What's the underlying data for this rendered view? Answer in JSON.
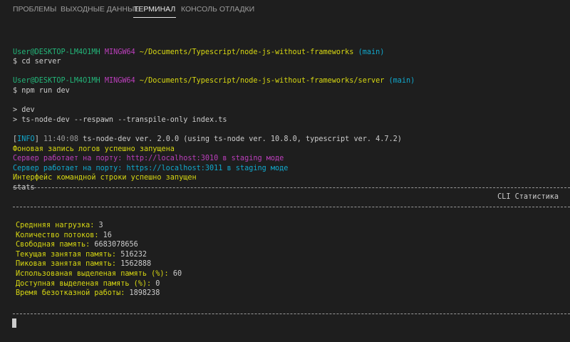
{
  "tabs": [
    {
      "label": "ПРОБЛЕМЫ",
      "active": false
    },
    {
      "label": "ВЫХОДНЫЕ ДАННЫЕ",
      "active": false
    },
    {
      "label": "ТЕРМИНАЛ",
      "active": true
    },
    {
      "label": "КОНСОЛЬ ОТЛАДКИ",
      "active": false
    }
  ],
  "terminal": {
    "lines": [
      [],
      [
        {
          "t": "User@DESKTOP-LM4O1MH ",
          "c": "green"
        },
        {
          "t": "MINGW64 ",
          "c": "magenta"
        },
        {
          "t": "~/Documents/Typescript/node-js-without-frameworks ",
          "c": "yellow"
        },
        {
          "t": "(main)",
          "c": "cyan"
        }
      ],
      [
        {
          "t": "$ cd server",
          "c": "default"
        }
      ],
      [],
      [
        {
          "t": "User@DESKTOP-LM4O1MH ",
          "c": "green"
        },
        {
          "t": "MINGW64 ",
          "c": "magenta"
        },
        {
          "t": "~/Documents/Typescript/node-js-without-frameworks/server ",
          "c": "yellow"
        },
        {
          "t": "(main)",
          "c": "cyan"
        }
      ],
      [
        {
          "t": "$ npm run dev",
          "c": "default"
        }
      ],
      [],
      [
        {
          "t": "> dev",
          "c": "default"
        }
      ],
      [
        {
          "t": "> ts-node-dev --respawn --transpile-only index.ts",
          "c": "default"
        }
      ],
      [],
      [
        {
          "t": "[",
          "c": "default"
        },
        {
          "t": "INFO",
          "c": "cyan"
        },
        {
          "t": "] ",
          "c": "default"
        },
        {
          "t": "11:40:08",
          "c": "gray"
        },
        {
          "t": " ts-node-dev ver. 2.0.0 (using ts-node ver. 10.8.0, typescript ver. 4.7.2)",
          "c": "default"
        }
      ],
      [
        {
          "t": "Фоновая запись логов успешно запущена",
          "c": "yellow"
        }
      ],
      [
        {
          "t": "Сервер работает на порту: http://localhost:3010 в staging моде",
          "c": "magenta"
        }
      ],
      [
        {
          "t": "Сервер работает на порту: https://localhost:3011 в staging моде",
          "c": "cyan"
        }
      ],
      [
        {
          "t": "Интерфейс командной строки успешно запущен",
          "c": "yellow"
        }
      ],
      [
        {
          "t": "stats",
          "c": "default"
        }
      ]
    ],
    "stats_title": "CLI Статистика",
    "stats": [
      {
        "label": "Среднняя нагрузка: ",
        "value": "3"
      },
      {
        "label": "Количество потоков: ",
        "value": "16"
      },
      {
        "label": "Свободная память: ",
        "value": "6683078656"
      },
      {
        "label": "Текущая занятая память: ",
        "value": "516232"
      },
      {
        "label": "Пиковая занятая память: ",
        "value": "1562888"
      },
      {
        "label": "Использованая выделеная память (%): ",
        "value": "60"
      },
      {
        "label": "Доступная выделеная память (%): ",
        "value": "0"
      },
      {
        "label": "Время безотказной работы: ",
        "value": "1898238"
      }
    ]
  }
}
